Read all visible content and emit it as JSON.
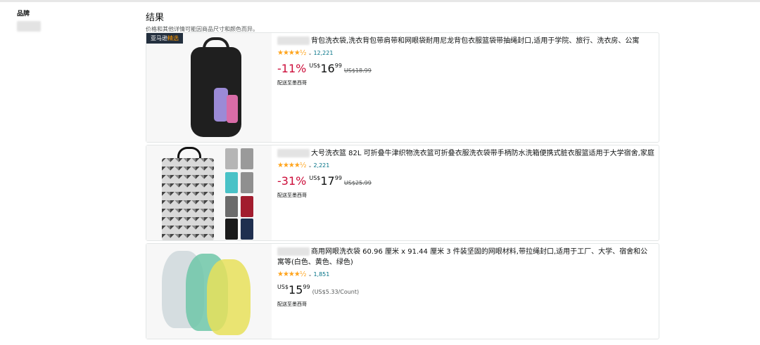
{
  "sidebar": {
    "brand_label": "品牌"
  },
  "results": {
    "title": "结果",
    "subtitle": "价格和其他详情可能因商品尺寸和颜色而异。"
  },
  "products": [
    {
      "badge_prefix": "亚马逊",
      "badge_highlight": "精选",
      "title": "背包洗衣袋,洗衣背包带肩带和网眼袋耐用尼龙背包衣服篮袋带抽绳封口,适用于学院、旅行、洗衣房、公寓",
      "stars": "★★★★½",
      "rating_count": "12,221",
      "discount": "-11%",
      "currency": "US$",
      "price_whole": "16",
      "price_fraction": "99",
      "list_price": "US$18.99",
      "delivery": "配送至墨西哥"
    },
    {
      "title": "大号洗衣篮 82L 可折叠牛津织物洗衣篮可折叠衣服洗衣袋带手柄防水洗箱便携式脏衣服篮适用于大学宿舍,家庭",
      "stars": "★★★★½",
      "rating_count": "2,221",
      "discount": "-31%",
      "currency": "US$",
      "price_whole": "17",
      "price_fraction": "99",
      "list_price": "US$25.99",
      "delivery": "配送至墨西哥"
    },
    {
      "title": "商用网眼洗衣袋 60.96 厘米 x 91.44 厘米 3 件装坚固的网眼材料,带拉绳封口,适用于工厂、大学、宿舍和公寓等(白色、黄色、绿色)",
      "stars": "★★★★½",
      "rating_count": "1,851",
      "currency": "US$",
      "price_whole": "15",
      "price_fraction": "99",
      "unit_price": "(US$5.33/Count)",
      "delivery": "配送至墨西哥"
    }
  ],
  "colors": {
    "star": "#ffa41c",
    "link": "#007185",
    "discount": "#cc0c39",
    "badge_bg": "#232f3e",
    "badge_highlight": "#ff9900"
  }
}
